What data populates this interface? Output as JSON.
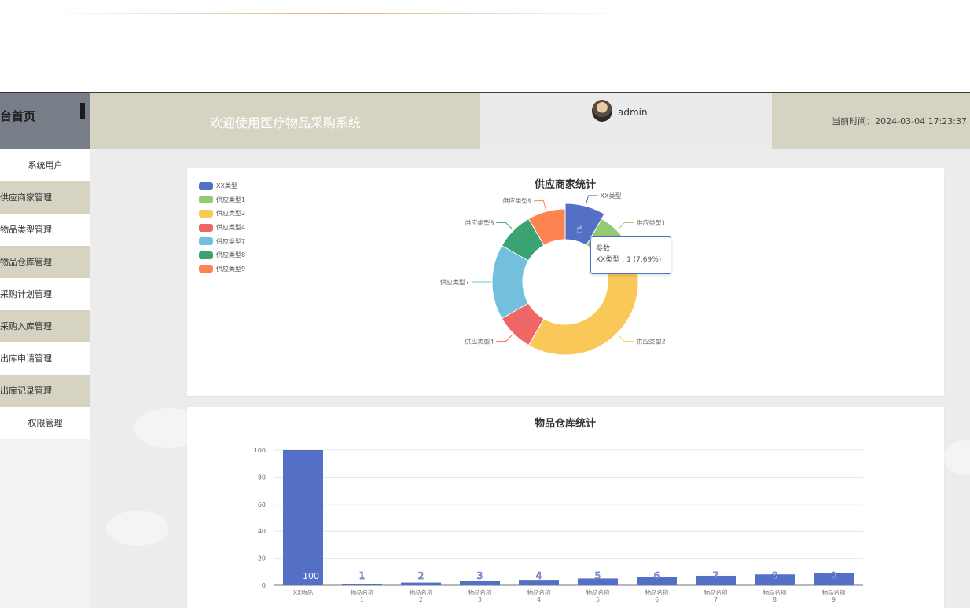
{
  "header": {
    "brand_title": "台首页",
    "welcome": "欢迎使用医疗物品采购系统",
    "username": "admin",
    "current_time": "当前时间：2024-03-04 17:23:37"
  },
  "sidebar": {
    "items": [
      {
        "label": "系统用户"
      },
      {
        "label": "供应商家管理"
      },
      {
        "label": "物品类型管理"
      },
      {
        "label": "物品仓库管理"
      },
      {
        "label": "采购计划管理"
      },
      {
        "label": "采购入库管理"
      },
      {
        "label": "出库申请管理"
      },
      {
        "label": "出库记录管理"
      },
      {
        "label": "权限管理"
      }
    ]
  },
  "pie_card": {
    "tooltip_title": "参数",
    "tooltip_value": "XX类型 : 1 (7.69%)"
  },
  "chart_data": [
    {
      "type": "pie",
      "title": "供应商家统计",
      "labels": [
        "XX类型",
        "供应类型1",
        "供应类型2",
        "供应类型4",
        "供应类型7",
        "供应类型8",
        "供应类型9"
      ],
      "values": [
        1,
        1,
        5,
        1,
        2,
        1,
        1
      ],
      "colors": [
        "#5470c6",
        "#91cc75",
        "#fac858",
        "#ee6666",
        "#73c0de",
        "#3ba272",
        "#fc8452"
      ],
      "donut": true,
      "legend": "top-left"
    },
    {
      "type": "bar",
      "title": "物品仓库统计",
      "categories": [
        "XX物品",
        "物品名称\n1",
        "物品名称\n2",
        "物品名称\n3",
        "物品名称\n4",
        "物品名称\n5",
        "物品名称\n6",
        "物品名称\n7",
        "物品名称\n8",
        "物品名称\n9"
      ],
      "values": [
        100,
        1,
        2,
        3,
        4,
        5,
        6,
        7,
        8,
        9
      ],
      "ylim": [
        0,
        100
      ],
      "yticks": [
        0,
        20,
        40,
        60,
        80,
        100
      ],
      "color": "#5470c6",
      "grid": true
    }
  ]
}
